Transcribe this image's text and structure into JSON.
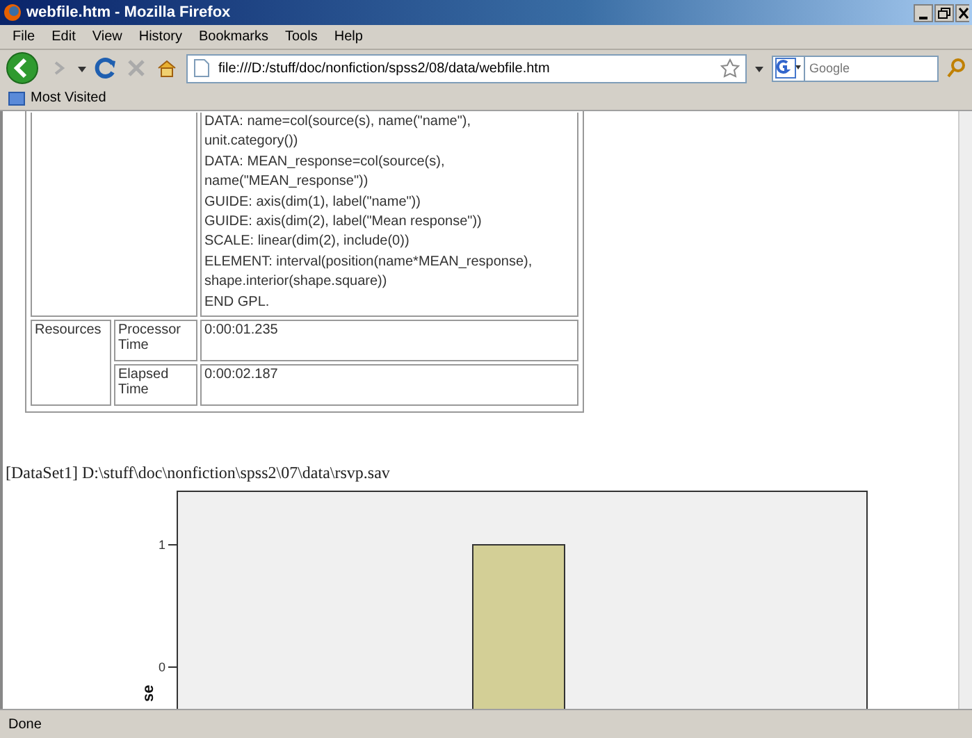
{
  "window": {
    "title": "webfile.htm - Mozilla Firefox"
  },
  "menu": [
    "File",
    "Edit",
    "View",
    "History",
    "Bookmarks",
    "Tools",
    "Help"
  ],
  "toolbar": {
    "address": "file:///D:/stuff/doc/nonfiction/spss2/08/data/webfile.htm",
    "search_placeholder": "Google"
  },
  "bookmarks": [
    "Most Visited"
  ],
  "syntax_table": {
    "code_lines": [
      "DATA: name=col(source(s), name(\"name\"),",
      "unit.category())",
      "DATA: MEAN_response=col(source(s),",
      "name(\"MEAN_response\"))",
      "GUIDE: axis(dim(1), label(\"name\"))",
      "GUIDE: axis(dim(2), label(\"Mean response\"))",
      "SCALE: linear(dim(2), include(0))",
      "ELEMENT: interval(position(name*MEAN_response),",
      "shape.interior(shape.square))",
      "END GPL."
    ],
    "rows": [
      {
        "label": "Resources",
        "items": [
          {
            "name": "Processor Time",
            "value": "0:00:01.235"
          },
          {
            "name": "Elapsed Time",
            "value": "0:00:02.187"
          }
        ]
      }
    ]
  },
  "dataset_line": "[DataSet1] D:\\stuff\\doc\\nonfiction\\spss2\\07\\data\\rsvp.sav",
  "chart": {
    "y_axis_title": "se",
    "y_tick_labels": [
      "1",
      "0"
    ]
  },
  "status_bar": "Done"
}
